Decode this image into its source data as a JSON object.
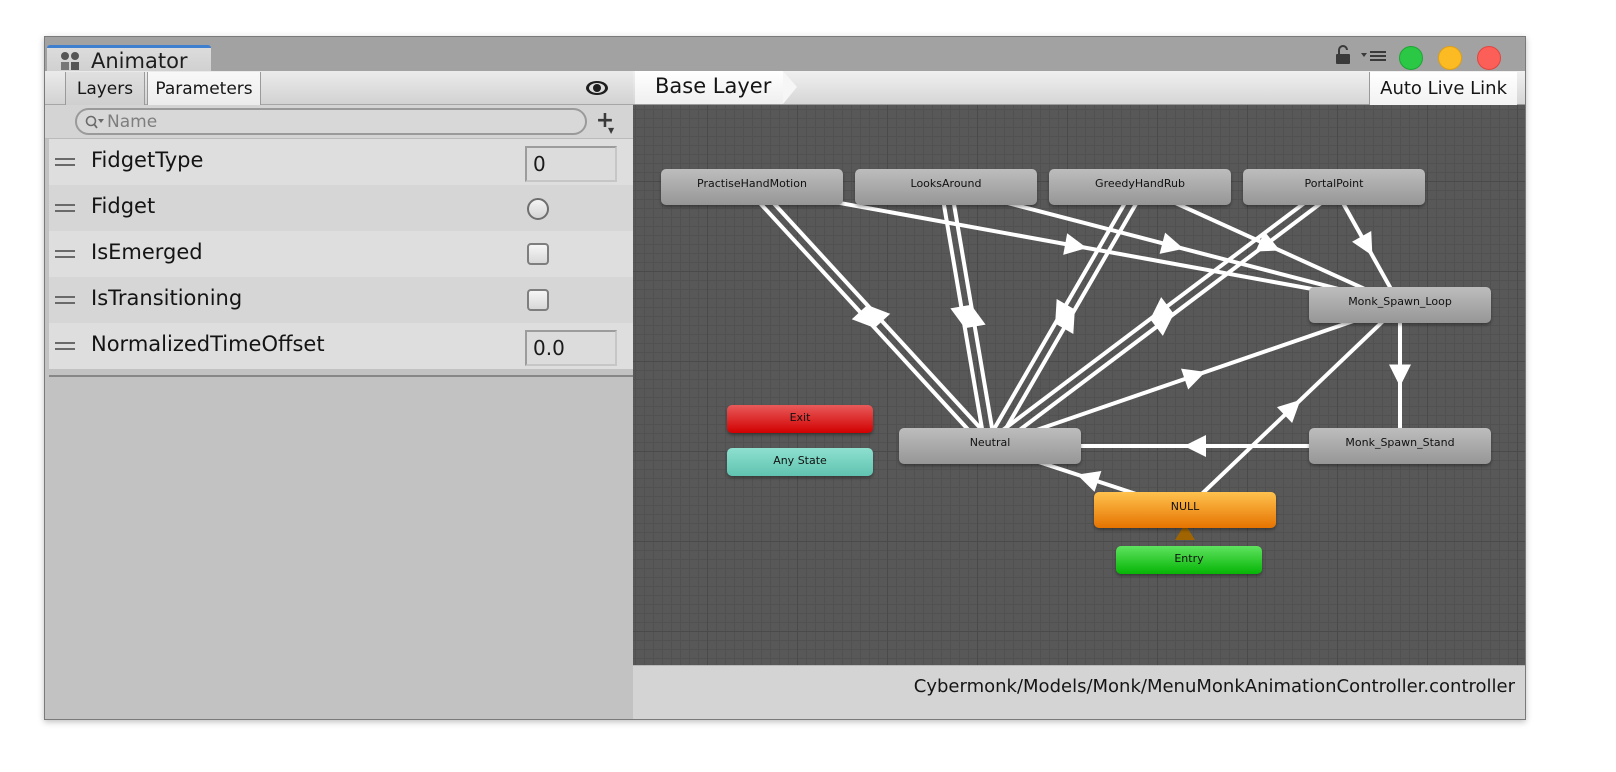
{
  "window": {
    "tab_title": "Animator",
    "icons": {
      "tab": "animator-icon",
      "lock": "lock-open-icon",
      "menu": "dropdown-menu-icon"
    },
    "traffic_light_colors": {
      "green": "#2ac845",
      "yellow": "#fcbb22",
      "red": "#fb5f57"
    }
  },
  "left_panel": {
    "tabs": [
      {
        "label": "Layers",
        "active": false
      },
      {
        "label": "Parameters",
        "active": true
      }
    ],
    "visibility_icon": "eye-icon",
    "search": {
      "placeholder": "Name",
      "value": ""
    },
    "add_button_label": "+",
    "parameters": [
      {
        "name": "FidgetType",
        "type": "int",
        "value": "0"
      },
      {
        "name": "Fidget",
        "type": "trigger",
        "value": false
      },
      {
        "name": "IsEmerged",
        "type": "bool",
        "value": false
      },
      {
        "name": "IsTransitioning",
        "type": "bool",
        "value": false
      },
      {
        "name": "NormalizedTimeOffset",
        "type": "float",
        "value": "0.0"
      }
    ]
  },
  "graph": {
    "breadcrumb": "Base Layer",
    "auto_live_link_label": "Auto Live Link",
    "states": [
      {
        "id": "practise",
        "label": "PractiseHandMotion",
        "kind": "state"
      },
      {
        "id": "looks",
        "label": "LooksAround",
        "kind": "state"
      },
      {
        "id": "greedy",
        "label": "GreedyHandRub",
        "kind": "state"
      },
      {
        "id": "portal",
        "label": "PortalPoint",
        "kind": "state"
      },
      {
        "id": "loop",
        "label": "Monk_Spawn_Loop",
        "kind": "state"
      },
      {
        "id": "exit",
        "label": "Exit",
        "kind": "exit"
      },
      {
        "id": "any",
        "label": "Any State",
        "kind": "any"
      },
      {
        "id": "neutral",
        "label": "Neutral",
        "kind": "state"
      },
      {
        "id": "stand",
        "label": "Monk_Spawn_Stand",
        "kind": "state"
      },
      {
        "id": "null",
        "label": "NULL",
        "kind": "default"
      },
      {
        "id": "entry",
        "label": "Entry",
        "kind": "entry"
      }
    ],
    "transitions": [
      {
        "from": "practise",
        "to": "neutral"
      },
      {
        "from": "neutral",
        "to": "practise"
      },
      {
        "from": "looks",
        "to": "neutral"
      },
      {
        "from": "neutral",
        "to": "looks"
      },
      {
        "from": "greedy",
        "to": "neutral"
      },
      {
        "from": "neutral",
        "to": "greedy"
      },
      {
        "from": "portal",
        "to": "neutral"
      },
      {
        "from": "neutral",
        "to": "portal"
      },
      {
        "from": "practise",
        "to": "loop"
      },
      {
        "from": "looks",
        "to": "loop"
      },
      {
        "from": "greedy",
        "to": "loop"
      },
      {
        "from": "portal",
        "to": "loop"
      },
      {
        "from": "neutral",
        "to": "loop"
      },
      {
        "from": "loop",
        "to": "stand"
      },
      {
        "from": "stand",
        "to": "neutral"
      },
      {
        "from": "null",
        "to": "neutral"
      },
      {
        "from": "null",
        "to": "loop"
      },
      {
        "from": "entry",
        "to": "null"
      }
    ],
    "colors": {
      "state": "#a9a9a9",
      "default_state": "#f39a1c",
      "entry": "#2fcc2f",
      "exit": "#dc2020",
      "any_state": "#76d2c0",
      "transition": "#ffffff",
      "entry_transition": "#a06400"
    }
  },
  "status": {
    "path": "Cybermonk/Models/Monk/MenuMonkAnimationController.controller"
  }
}
